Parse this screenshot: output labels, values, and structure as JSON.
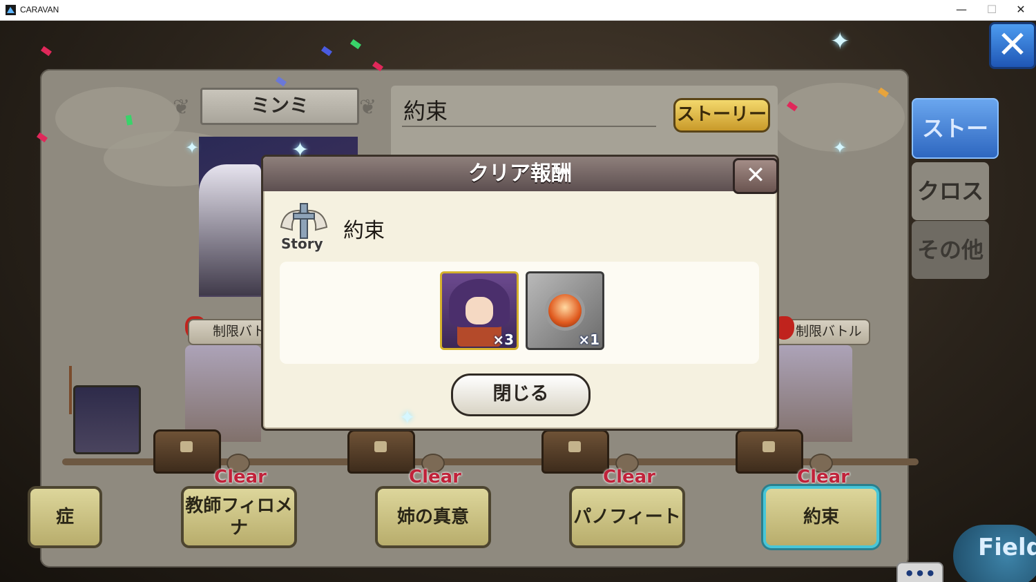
{
  "window": {
    "title": "CARAVAN",
    "minimize": "—",
    "maximize": "☐",
    "close": "✕"
  },
  "header": {
    "character_name": "ミンミ",
    "story_title": "約束",
    "story_button": "ストーリー"
  },
  "side_tabs": [
    "ストーリー",
    "クロス",
    "その他"
  ],
  "close_main": "✕",
  "limit_badges": [
    "制限バト",
    "制限バトル"
  ],
  "stages": [
    {
      "label": "症",
      "clear": ""
    },
    {
      "label": "教師フィロメナ",
      "clear": "Clear"
    },
    {
      "label": "姉の真意",
      "clear": "Clear"
    },
    {
      "label": "パノフィート",
      "clear": "Clear"
    },
    {
      "label": "約束",
      "clear": "Clear"
    }
  ],
  "field_button": "Field",
  "more_button": "•••",
  "modal": {
    "title": "クリア報酬",
    "close_icon": "✕",
    "emblem_label": "Story",
    "story_name": "約束",
    "rewards": [
      {
        "icon": "character-portrait-icon",
        "quantity": "×3"
      },
      {
        "icon": "fire-orb-icon",
        "quantity": "×1"
      }
    ],
    "close_button": "閉じる"
  },
  "colors": {
    "accent_blue": "#2e67c0",
    "clear_red": "#c0223a",
    "gold": "#d4b12c"
  }
}
